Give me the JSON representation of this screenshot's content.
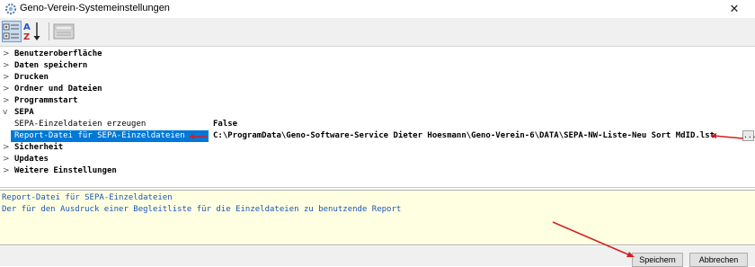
{
  "window": {
    "title": "Geno-Verein-Systemeinstellungen",
    "icon": "gear-icon",
    "close_label": "✕"
  },
  "toolbar": {
    "categorized_icon": "categorized-view-icon",
    "alphabetical_icon": "sort-az-icon",
    "property_pages_icon": "property-pages-icon"
  },
  "grid": {
    "categories": [
      {
        "label": "Benutzeroberfläche",
        "expanded": false
      },
      {
        "label": "Daten speichern",
        "expanded": false
      },
      {
        "label": "Drucken",
        "expanded": false
      },
      {
        "label": "Ordner und Dateien",
        "expanded": false
      },
      {
        "label": "Programmstart",
        "expanded": false
      },
      {
        "label": "SEPA",
        "expanded": true
      },
      {
        "label": "Sicherheit",
        "expanded": false
      },
      {
        "label": "Updates",
        "expanded": false
      },
      {
        "label": "Weitere Einstellungen",
        "expanded": false
      }
    ],
    "sepa_properties": [
      {
        "name": "SEPA-Einzeldateien erzeugen",
        "value": "False",
        "selected": false
      },
      {
        "name": "Report-Datei für SEPA-Einzeldateien",
        "value": "C:\\ProgramData\\Geno-Software-Service Dieter Hoesmann\\Geno-Verein-6\\DATA\\SEPA-NW-Liste-Neu Sort MdID.lst",
        "selected": true
      }
    ],
    "browse_label": "..."
  },
  "description": {
    "title": "Report-Datei für SEPA-Einzeldateien",
    "text": "Der für den Ausdruck einer Begleitliste für die Einzeldateien zu benutzende Report"
  },
  "buttons": {
    "save": "Speichern",
    "cancel": "Abbrechen"
  },
  "colors": {
    "selection": "#0078d7",
    "description_bg": "#ffffe1",
    "description_text": "#1a56b8",
    "annotation_arrow": "#d42020"
  }
}
